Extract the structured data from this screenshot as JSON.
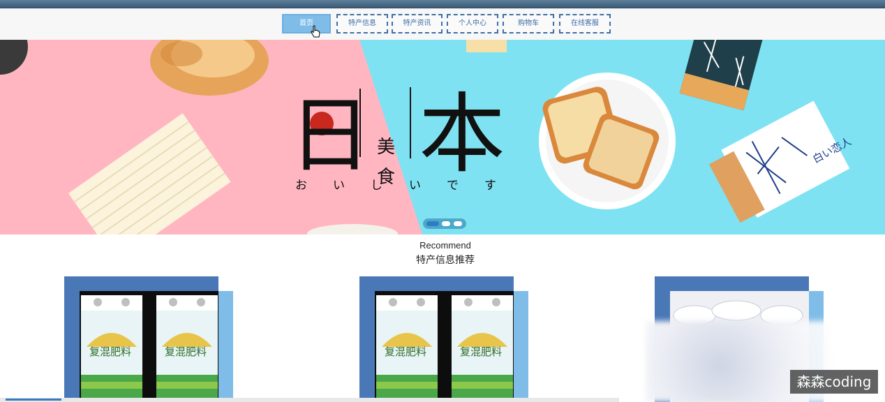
{
  "nav": {
    "items": [
      {
        "label": "首页",
        "active": true
      },
      {
        "label": "特产信息",
        "active": false
      },
      {
        "label": "特产资讯",
        "active": false
      },
      {
        "label": "个人中心",
        "active": false
      },
      {
        "label": "购物车",
        "active": false
      },
      {
        "label": "在线客服",
        "active": false
      }
    ]
  },
  "banner": {
    "big_left": "日",
    "big_right": "本",
    "small_top": "美",
    "small_bottom": "食",
    "kana": [
      "お",
      "い",
      "し",
      "い",
      "で",
      "す"
    ],
    "package_text": "白い恋人",
    "slides_total": 3,
    "slide_active": 1,
    "colors": {
      "left_bg": "#ffb6c1",
      "right_bg": "#7fe2f2",
      "sun": "#c8281e"
    }
  },
  "recommend": {
    "title": "Recommend",
    "subtitle": "特产信息推荐"
  },
  "products": [
    {
      "image_text": "复混肥料"
    },
    {
      "image_text": "复混肥料"
    },
    {
      "image_text": ""
    }
  ],
  "watermark": "森森coding",
  "colors": {
    "accent": "#3d6ea6",
    "card_back": "#4a78b6",
    "card_side": "#7fbde8"
  }
}
